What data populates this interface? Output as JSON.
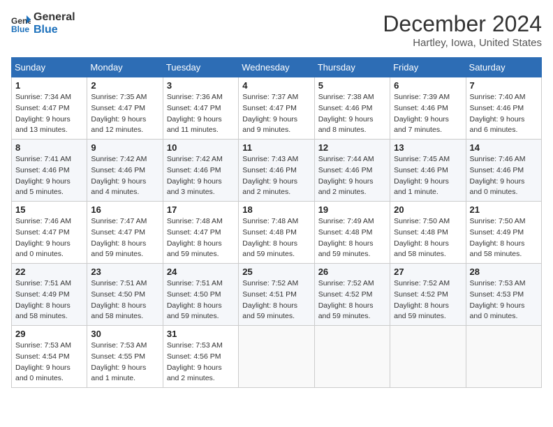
{
  "header": {
    "logo_line1": "General",
    "logo_line2": "Blue",
    "month_title": "December 2024",
    "location": "Hartley, Iowa, United States"
  },
  "weekdays": [
    "Sunday",
    "Monday",
    "Tuesday",
    "Wednesday",
    "Thursday",
    "Friday",
    "Saturday"
  ],
  "weeks": [
    [
      {
        "day": "1",
        "sunrise": "Sunrise: 7:34 AM",
        "sunset": "Sunset: 4:47 PM",
        "daylight": "Daylight: 9 hours and 13 minutes."
      },
      {
        "day": "2",
        "sunrise": "Sunrise: 7:35 AM",
        "sunset": "Sunset: 4:47 PM",
        "daylight": "Daylight: 9 hours and 12 minutes."
      },
      {
        "day": "3",
        "sunrise": "Sunrise: 7:36 AM",
        "sunset": "Sunset: 4:47 PM",
        "daylight": "Daylight: 9 hours and 11 minutes."
      },
      {
        "day": "4",
        "sunrise": "Sunrise: 7:37 AM",
        "sunset": "Sunset: 4:47 PM",
        "daylight": "Daylight: 9 hours and 9 minutes."
      },
      {
        "day": "5",
        "sunrise": "Sunrise: 7:38 AM",
        "sunset": "Sunset: 4:46 PM",
        "daylight": "Daylight: 9 hours and 8 minutes."
      },
      {
        "day": "6",
        "sunrise": "Sunrise: 7:39 AM",
        "sunset": "Sunset: 4:46 PM",
        "daylight": "Daylight: 9 hours and 7 minutes."
      },
      {
        "day": "7",
        "sunrise": "Sunrise: 7:40 AM",
        "sunset": "Sunset: 4:46 PM",
        "daylight": "Daylight: 9 hours and 6 minutes."
      }
    ],
    [
      {
        "day": "8",
        "sunrise": "Sunrise: 7:41 AM",
        "sunset": "Sunset: 4:46 PM",
        "daylight": "Daylight: 9 hours and 5 minutes."
      },
      {
        "day": "9",
        "sunrise": "Sunrise: 7:42 AM",
        "sunset": "Sunset: 4:46 PM",
        "daylight": "Daylight: 9 hours and 4 minutes."
      },
      {
        "day": "10",
        "sunrise": "Sunrise: 7:42 AM",
        "sunset": "Sunset: 4:46 PM",
        "daylight": "Daylight: 9 hours and 3 minutes."
      },
      {
        "day": "11",
        "sunrise": "Sunrise: 7:43 AM",
        "sunset": "Sunset: 4:46 PM",
        "daylight": "Daylight: 9 hours and 2 minutes."
      },
      {
        "day": "12",
        "sunrise": "Sunrise: 7:44 AM",
        "sunset": "Sunset: 4:46 PM",
        "daylight": "Daylight: 9 hours and 2 minutes."
      },
      {
        "day": "13",
        "sunrise": "Sunrise: 7:45 AM",
        "sunset": "Sunset: 4:46 PM",
        "daylight": "Daylight: 9 hours and 1 minute."
      },
      {
        "day": "14",
        "sunrise": "Sunrise: 7:46 AM",
        "sunset": "Sunset: 4:46 PM",
        "daylight": "Daylight: 9 hours and 0 minutes."
      }
    ],
    [
      {
        "day": "15",
        "sunrise": "Sunrise: 7:46 AM",
        "sunset": "Sunset: 4:47 PM",
        "daylight": "Daylight: 9 hours and 0 minutes."
      },
      {
        "day": "16",
        "sunrise": "Sunrise: 7:47 AM",
        "sunset": "Sunset: 4:47 PM",
        "daylight": "Daylight: 8 hours and 59 minutes."
      },
      {
        "day": "17",
        "sunrise": "Sunrise: 7:48 AM",
        "sunset": "Sunset: 4:47 PM",
        "daylight": "Daylight: 8 hours and 59 minutes."
      },
      {
        "day": "18",
        "sunrise": "Sunrise: 7:48 AM",
        "sunset": "Sunset: 4:48 PM",
        "daylight": "Daylight: 8 hours and 59 minutes."
      },
      {
        "day": "19",
        "sunrise": "Sunrise: 7:49 AM",
        "sunset": "Sunset: 4:48 PM",
        "daylight": "Daylight: 8 hours and 59 minutes."
      },
      {
        "day": "20",
        "sunrise": "Sunrise: 7:50 AM",
        "sunset": "Sunset: 4:48 PM",
        "daylight": "Daylight: 8 hours and 58 minutes."
      },
      {
        "day": "21",
        "sunrise": "Sunrise: 7:50 AM",
        "sunset": "Sunset: 4:49 PM",
        "daylight": "Daylight: 8 hours and 58 minutes."
      }
    ],
    [
      {
        "day": "22",
        "sunrise": "Sunrise: 7:51 AM",
        "sunset": "Sunset: 4:49 PM",
        "daylight": "Daylight: 8 hours and 58 minutes."
      },
      {
        "day": "23",
        "sunrise": "Sunrise: 7:51 AM",
        "sunset": "Sunset: 4:50 PM",
        "daylight": "Daylight: 8 hours and 58 minutes."
      },
      {
        "day": "24",
        "sunrise": "Sunrise: 7:51 AM",
        "sunset": "Sunset: 4:50 PM",
        "daylight": "Daylight: 8 hours and 59 minutes."
      },
      {
        "day": "25",
        "sunrise": "Sunrise: 7:52 AM",
        "sunset": "Sunset: 4:51 PM",
        "daylight": "Daylight: 8 hours and 59 minutes."
      },
      {
        "day": "26",
        "sunrise": "Sunrise: 7:52 AM",
        "sunset": "Sunset: 4:52 PM",
        "daylight": "Daylight: 8 hours and 59 minutes."
      },
      {
        "day": "27",
        "sunrise": "Sunrise: 7:52 AM",
        "sunset": "Sunset: 4:52 PM",
        "daylight": "Daylight: 8 hours and 59 minutes."
      },
      {
        "day": "28",
        "sunrise": "Sunrise: 7:53 AM",
        "sunset": "Sunset: 4:53 PM",
        "daylight": "Daylight: 9 hours and 0 minutes."
      }
    ],
    [
      {
        "day": "29",
        "sunrise": "Sunrise: 7:53 AM",
        "sunset": "Sunset: 4:54 PM",
        "daylight": "Daylight: 9 hours and 0 minutes."
      },
      {
        "day": "30",
        "sunrise": "Sunrise: 7:53 AM",
        "sunset": "Sunset: 4:55 PM",
        "daylight": "Daylight: 9 hours and 1 minute."
      },
      {
        "day": "31",
        "sunrise": "Sunrise: 7:53 AM",
        "sunset": "Sunset: 4:56 PM",
        "daylight": "Daylight: 9 hours and 2 minutes."
      },
      null,
      null,
      null,
      null
    ]
  ]
}
